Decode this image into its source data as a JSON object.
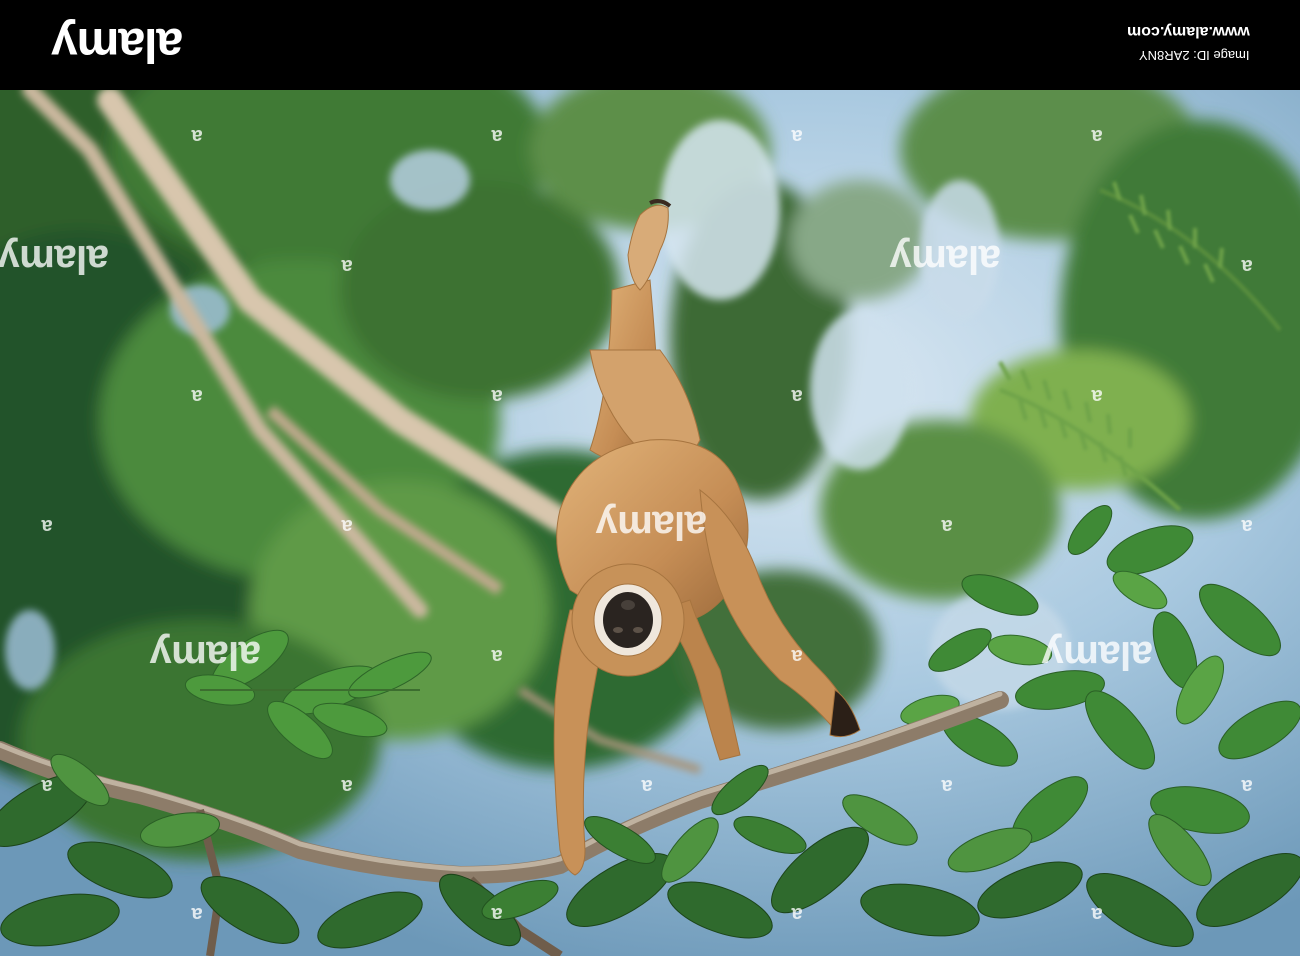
{
  "header": {
    "logo": "alamy",
    "url": "www.alamy.com",
    "image_id": "Image ID: 2AR8NY"
  },
  "watermark": {
    "text": "alamy",
    "glyph": "a"
  },
  "photo": {
    "subject": "gibbon-hanging-upside-down",
    "colors": {
      "sky": "#bcd8ec",
      "foliage_dark": "#1f4a22",
      "foliage_mid": "#3f7d33",
      "foliage_light": "#7fb24e",
      "fur": "#c8955a",
      "branch": "#8a7a68"
    }
  }
}
